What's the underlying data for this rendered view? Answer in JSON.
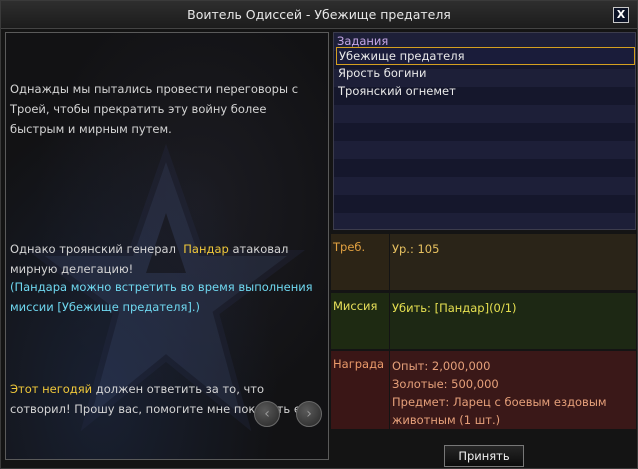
{
  "window": {
    "title": "Воитель Одиссей - Убежище предателя",
    "close_label": "X"
  },
  "dialog": {
    "p1": "Однажды мы пытались провести переговоры с Троей, чтобы прекратить эту войну более быстрым и мирным путем.",
    "p2_before": "Однако троянский генерал",
    "p2_name": "Пандар",
    "p2_after": "атаковал мирную делегацию!",
    "p3_highlight": "Этот негодяй",
    "p3_after": "должен ответить за то, что сотворил! Прошу вас, помогите мне покарать его.",
    "hint": "(Пандара можно встретить во время выполнения миссии [Убежище предателя].)",
    "prev_label": "‹",
    "next_label": "›"
  },
  "quests": {
    "header": "Задания",
    "items": [
      {
        "label": "Убежище предателя",
        "selected": true
      },
      {
        "label": "Ярость богини",
        "selected": false
      },
      {
        "label": "Троянский огнемет",
        "selected": false
      }
    ]
  },
  "details": {
    "requirement_label": "Треб.",
    "requirement_value": "Ур.: 105",
    "mission_label": "Миссия",
    "mission_value": "Убить: [Пандар](0/1)",
    "reward_label": "Награда",
    "reward_exp": "Опыт: 2,000,000",
    "reward_gold": "Золотые: 500,000",
    "reward_item": "Предмет: Ларец с боевым ездовым животным (1 шт.)"
  },
  "accept_label": "Принять"
}
